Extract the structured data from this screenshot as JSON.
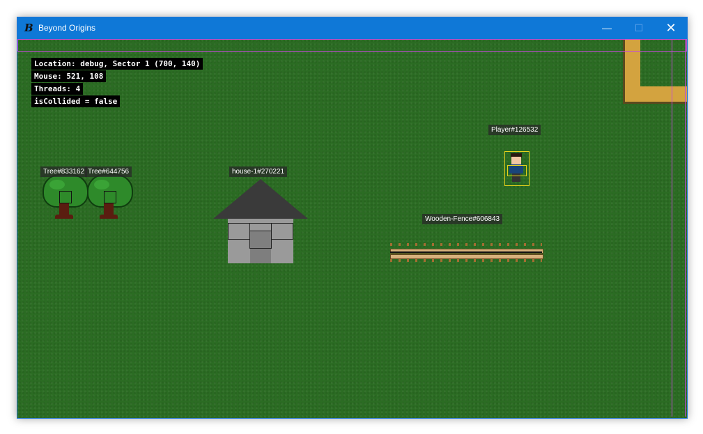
{
  "window": {
    "title": "Beyond Origins",
    "icon_letter": "B",
    "controls": {
      "minimize": "—",
      "maximize": "☐",
      "close": "✕"
    }
  },
  "debug": {
    "location": "Location: debug, Sector 1 (700, 140)",
    "mouse": "Mouse: 521, 108",
    "threads": "Threads: 4",
    "collided": "isCollided = false"
  },
  "entities": {
    "tree1_label": "Tree#833162",
    "tree2_label": "Tree#644756",
    "house_label": "house-1#270221",
    "fence_label": "Wooden-Fence#606843",
    "player_label": "Player#126532"
  },
  "colors": {
    "titlebar": "#0f78d7",
    "grass": "#2b6c23",
    "path": "#d3a33f",
    "bounds": "#c54bd8",
    "hitbox": "#e6d21c"
  }
}
